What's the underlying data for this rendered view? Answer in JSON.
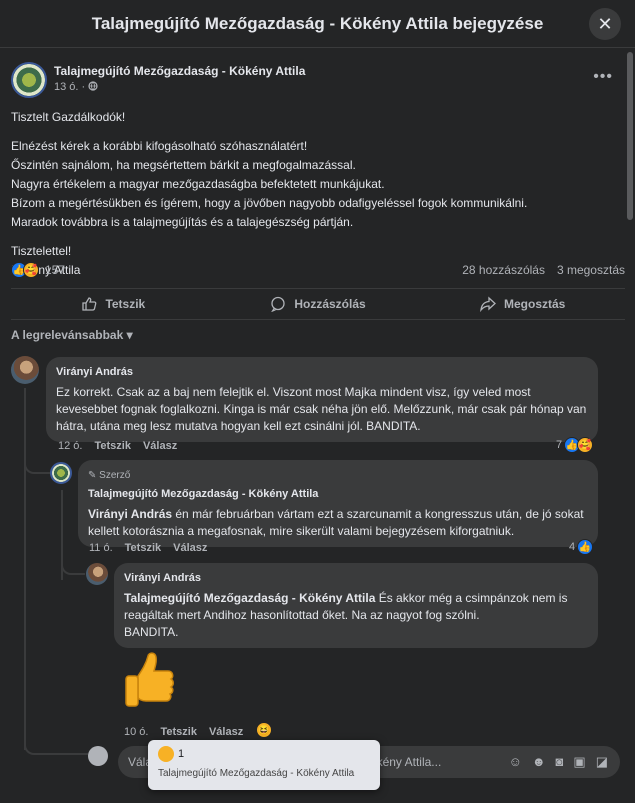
{
  "header": {
    "title": "Talajmegújító Mezőgazdaság - Kökény Attila bejegyzése",
    "close_glyph": "✕"
  },
  "post": {
    "author": "Talajmegújító Mezőgazdaság - Kökény Attila",
    "time": "13 ó. · ",
    "privacy_icon": "globe-icon",
    "greeting": "Tisztelt Gazdálkodók!",
    "lines": [
      "Elnézést kérek a korábbi kifogásolható szóhasználatért!",
      "Őszintén sajnálom, ha megsértettem bárkit a megfogalmazással.",
      "Nagyra értékelem a magyar mezőgazdaságba befektetett munkájukat.",
      "Bízom a megértésükben és ígérem, hogy a jövőben nagyobb odafigyeléssel fogok kommunikálni.",
      "Maradok továbbra is a talajmegújítás és a talajegészség pártján."
    ],
    "closing": "Tisztelettel!",
    "signature": "Kökény Attila",
    "reaction_count": "157",
    "comments_count": "28 hozzászólás",
    "shares_count": "3 megosztás"
  },
  "actions": {
    "like": "Tetszik",
    "comment": "Hozzászólás",
    "share": "Megosztás"
  },
  "sort_label": "A legrelevánsabbak",
  "comments": [
    {
      "author": "Virányi András",
      "text": "Ez korrekt. Csak az a baj nem felejtik el. Viszont most Majka mindent visz, így veled most kevesebbet fognak foglalkozni. Kinga is már csak néha jön elő. Melőzzunk, már csak pár hónap van hátra, utána meg lesz mutatva hogyan kell ezt csinálni jól. BANDITA.",
      "time": "12 ó.",
      "like": "Tetszik",
      "reply": "Válasz",
      "reactions": "7"
    },
    {
      "author_tag": "Szerző",
      "author": "Talajmegújító Mezőgazdaság - Kökény Attila",
      "mention": "Virányi András",
      "text": " én már februárban vártam ezt a szarcunamit a kongresszus után, de jó sokat kellett kotorásznia a megafosnak, mire sikerült valami bejegyzésem kiforgatniuk.",
      "time": "11 ó.",
      "like": "Tetszik",
      "reply": "Válasz",
      "reactions": "4"
    },
    {
      "author": "Virányi András",
      "mention": "Talajmegújító Mezőgazdaság - Kökény Attila",
      "text": " És akkor még a csimpánzok nem is reagáltak mert Andihoz hasonlítottad őket. Na az nagyot fog szólni.",
      "text2": "BANDITA.",
      "time": "10 ó.",
      "like": "Tetszik",
      "reply": "Válasz"
    }
  ],
  "reply_box": {
    "placeholder": "Válasz neki: Talajmegújító Mezőgazdaság - Kökény Attila..."
  },
  "tooltip": {
    "count": "1",
    "name": "Talajmegújító Mezőgazdaság - Kökény Attila"
  },
  "colors": {
    "background": "#242526",
    "bubble": "#3a3b3c",
    "like_blue": "#1877f2"
  }
}
